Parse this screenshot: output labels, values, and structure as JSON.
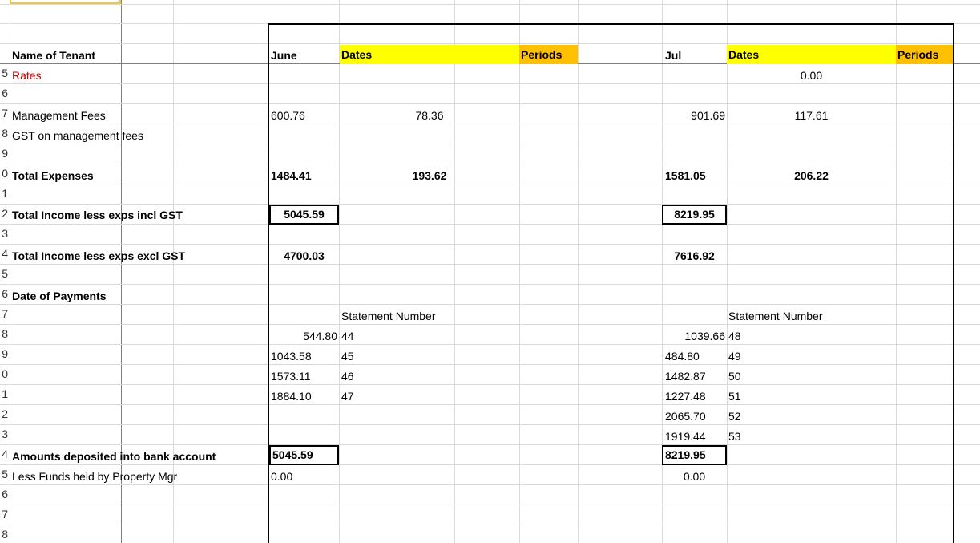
{
  "row_headers": [
    "5",
    "6",
    "7",
    "8",
    "9",
    "0",
    "1",
    "2",
    "3",
    "4",
    "5",
    "6",
    "7",
    "8",
    "9",
    "0",
    "1",
    "2",
    "3",
    "4",
    "5",
    "6",
    "7",
    "8"
  ],
  "header": {
    "name_of_tenant": "Name of Tenant",
    "june": "June",
    "dates_june": "Dates",
    "periods_june": "Periods",
    "jul": "Jul",
    "dates_jul": "Dates",
    "periods_jul": "Periods"
  },
  "labels": {
    "rates": "Rates",
    "management_fees": "Management Fees",
    "gst_on_management_fees": "GST on management fees",
    "total_expenses": "Total Expenses",
    "total_income_incl_gst": "Total Income less exps incl GST",
    "total_income_excl_gst": "Total Income less exps excl GST",
    "date_of_payments": "Date of Payments",
    "amounts_deposited": "Amounts deposited into bank account",
    "less_funds_held": "Less Funds held by Property Mgr"
  },
  "values": {
    "rates_jul_dates": "0.00",
    "mgmt_june": "600.76",
    "mgmt_june_dates": "78.36",
    "mgmt_jul": "901.69",
    "mgmt_jul_dates": "117.61",
    "total_exp_june": "1484.41",
    "total_exp_june_dates": "193.62",
    "total_exp_jul": "1581.05",
    "total_exp_jul_dates": "206.22",
    "income_incl_june": "5045.59",
    "income_incl_jul": "8219.95",
    "income_excl_june": "4700.03",
    "income_excl_jul": "7616.92",
    "statement_number_june": "Statement Number",
    "statement_number_jul": "Statement Number",
    "deposited_june": "5045.59",
    "deposited_jul": "8219.95",
    "funds_held_june": "0.00",
    "funds_held_jul": "0.00"
  },
  "payments_june": [
    {
      "amount": "544.80",
      "statement": "44"
    },
    {
      "amount": "1043.58",
      "statement": "45"
    },
    {
      "amount": "1573.11",
      "statement": "46"
    },
    {
      "amount": "1884.10",
      "statement": "47"
    }
  ],
  "payments_jul": [
    {
      "amount": "1039.66",
      "statement": "48"
    },
    {
      "amount": "484.80",
      "statement": "49"
    },
    {
      "amount": "1482.87",
      "statement": "50"
    },
    {
      "amount": "1227.48",
      "statement": "51"
    },
    {
      "amount": "2065.70",
      "statement": "52"
    },
    {
      "amount": "1919.44",
      "statement": "53"
    }
  ],
  "colors": {
    "header_yellow": "#ffff00",
    "header_orange": "#ffc000",
    "rates_red": "#d40000",
    "gridline": "#d9d9d9"
  }
}
